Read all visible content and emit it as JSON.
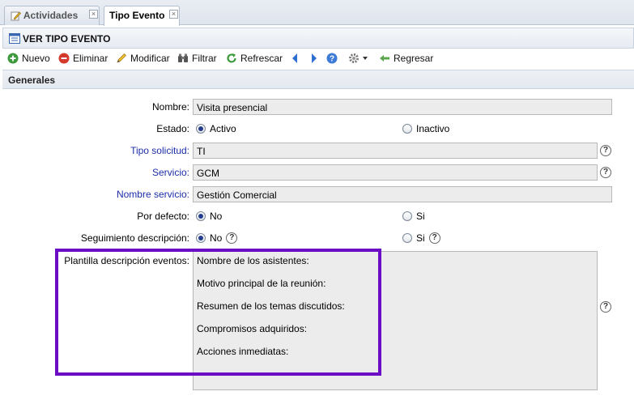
{
  "tabs": [
    {
      "label": "Actividades",
      "close": "×"
    },
    {
      "label": "Tipo Evento",
      "close": "×"
    }
  ],
  "panel": {
    "title": "VER TIPO EVENTO"
  },
  "toolbar": {
    "nuevo": "Nuevo",
    "eliminar": "Eliminar",
    "modificar": "Modificar",
    "filtrar": "Filtrar",
    "refrescar": "Refrescar",
    "regresar": "Regresar"
  },
  "section": {
    "title": "Generales"
  },
  "form": {
    "nombre_label": "Nombre:",
    "nombre_value": "Visita presencial",
    "estado_label": "Estado:",
    "estado_activo": "Activo",
    "estado_inactivo": "Inactivo",
    "tipo_solicitud_label": "Tipo solicitud:",
    "tipo_solicitud_value": "TI",
    "servicio_label": "Servicio:",
    "servicio_value": "GCM",
    "nombre_servicio_label": "Nombre servicio:",
    "nombre_servicio_value": "Gestión Comercial",
    "por_defecto_label": "Por defecto:",
    "por_defecto_no": "No",
    "por_defecto_si": "Si",
    "seguimiento_label": "Seguimiento descripción:",
    "seguimiento_no": "No",
    "seguimiento_si": "Si",
    "plantilla_label": "Plantilla descripción eventos:",
    "plantilla_lines": [
      "Nombre de los asistentes:",
      "Motivo principal de la reunión:",
      "Resumen de los temas discutidos:",
      "Compromisos adquiridos:",
      "Acciones inmediatas:"
    ],
    "help_glyph": "?"
  },
  "colors": {
    "highlight": "#6a0dc4",
    "link_label": "#1c2ea8"
  }
}
